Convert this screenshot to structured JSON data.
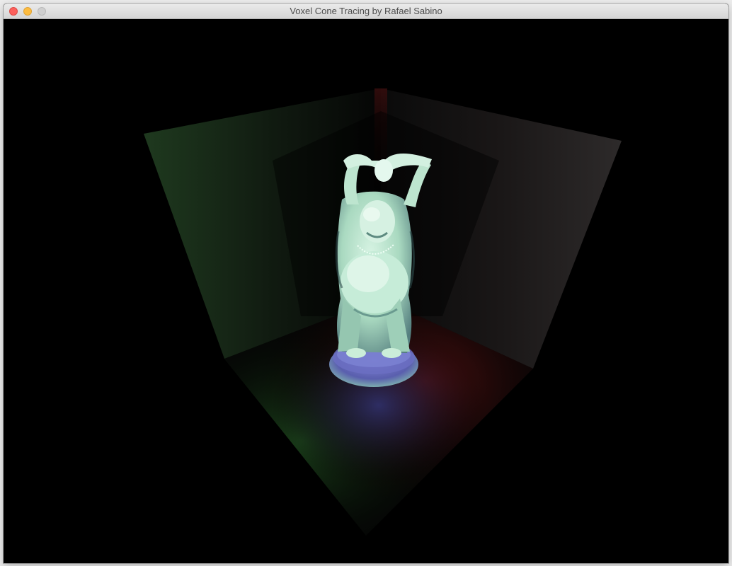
{
  "window": {
    "title": "Voxel Cone Tracing by Rafael Sabino",
    "controls": [
      "close",
      "minimize",
      "zoom"
    ]
  },
  "scene": {
    "background": "#000000",
    "room": {
      "left_wall_color": "#1f3b1f",
      "right_wall_color": "#2a2828",
      "floor_red_tint": "#5a1010",
      "floor_green_tint": "#1d4a1d",
      "floor_blue_tint": "#2b2e6a"
    },
    "model": {
      "name": "buddha-statue",
      "tint": "#b9e6cf"
    }
  }
}
